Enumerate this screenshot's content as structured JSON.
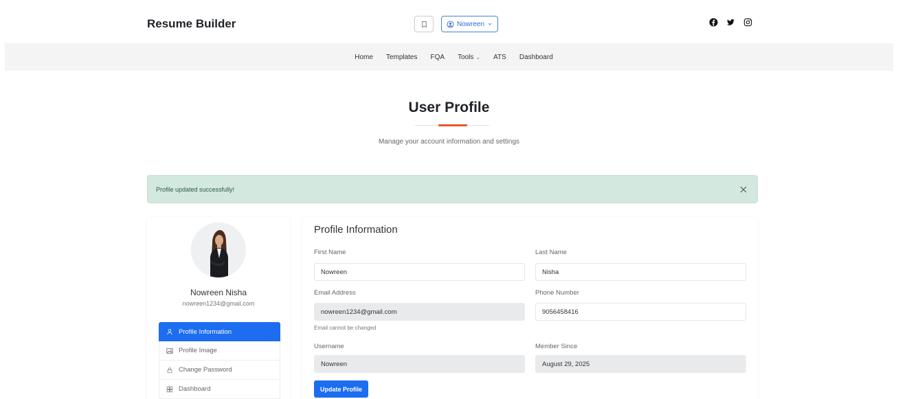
{
  "header": {
    "brand": "Resume Builder",
    "user_button_label": "Nowreen",
    "icons": [
      "bookmark-icon",
      "user-circle-icon",
      "chevron-down-icon",
      "facebook-icon",
      "twitter-icon",
      "instagram-icon"
    ]
  },
  "nav": {
    "items": [
      "Home",
      "Templates",
      "FQA",
      "Tools",
      "ATS",
      "Dashboard"
    ]
  },
  "page": {
    "title": "User Profile",
    "subtitle": "Manage your account information and settings",
    "accent_color": "#e8572a"
  },
  "alert": {
    "message": "Profile updated successfully!",
    "background": "#d3e8de"
  },
  "profile": {
    "name": "Nowreen Nisha",
    "email": "nowreen1234@gmail.com",
    "menu": [
      {
        "label": "Profile Information",
        "icon": "user-icon",
        "active": true
      },
      {
        "label": "Profile Image",
        "icon": "image-icon",
        "active": false
      },
      {
        "label": "Change Password",
        "icon": "lock-icon",
        "active": false
      },
      {
        "label": "Dashboard",
        "icon": "dashboard-icon",
        "active": false
      }
    ]
  },
  "form": {
    "title": "Profile Information",
    "first_name_label": "First Name",
    "first_name_value": "Nowreen",
    "last_name_label": "Last Name",
    "last_name_value": "Nisha",
    "email_label": "Email Address",
    "email_value": "nowreen1234@gmail.com",
    "email_help": "Email cannot be changed",
    "phone_label": "Phone Number",
    "phone_value": "9056458416",
    "username_label": "Username",
    "username_value": "Nowreen",
    "member_since_label": "Member Since",
    "member_since_value": "August 29, 2025",
    "submit_label": "Update Profile",
    "primary_color": "#1d6df0"
  }
}
